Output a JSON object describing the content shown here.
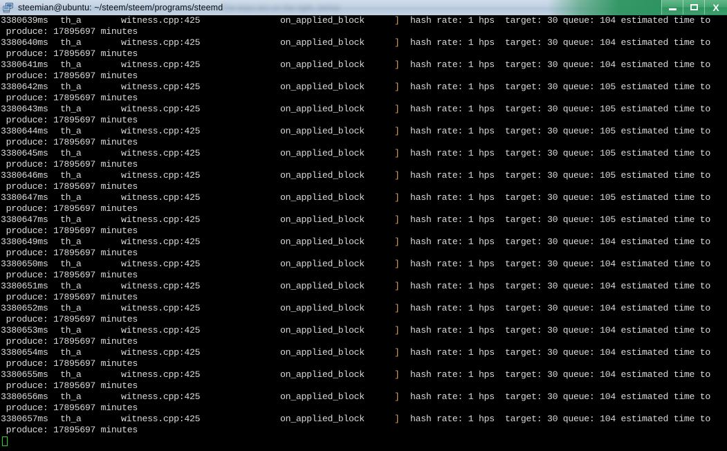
{
  "window": {
    "title": "steemian@ubuntu: ~/steem/steem/programs/steemd",
    "icon": "putty-computers-icon",
    "background_hint_text": "The  keys are on the right, below.",
    "colors": {
      "terminal_background": "#000000",
      "terminal_foreground": "#d6d6d6",
      "bracket_accent": "#c8a06a",
      "cursor": "#22dd22",
      "titlebar_glass": "#cbdbee",
      "titlebar_green": "#248e5a"
    },
    "controls": {
      "minimize_label": "–",
      "maximize_label": "□",
      "close_label": "X"
    }
  },
  "terminal": {
    "log_lines": [
      {
        "timestamp": "3380639ms",
        "thread": "th_a",
        "source": "witness.cpp:425",
        "function": "on_applied_block",
        "bracket": "]",
        "message": "hash rate: 1 hps  target: 30 queue: 104 estimated time to",
        "continuation": " produce: 17895697 minutes"
      },
      {
        "timestamp": "3380640ms",
        "thread": "th_a",
        "source": "witness.cpp:425",
        "function": "on_applied_block",
        "bracket": "]",
        "message": "hash rate: 1 hps  target: 30 queue: 104 estimated time to",
        "continuation": " produce: 17895697 minutes"
      },
      {
        "timestamp": "3380641ms",
        "thread": "th_a",
        "source": "witness.cpp:425",
        "function": "on_applied_block",
        "bracket": "]",
        "message": "hash rate: 1 hps  target: 30 queue: 104 estimated time to",
        "continuation": " produce: 17895697 minutes"
      },
      {
        "timestamp": "3380642ms",
        "thread": "th_a",
        "source": "witness.cpp:425",
        "function": "on_applied_block",
        "bracket": "]",
        "message": "hash rate: 1 hps  target: 30 queue: 105 estimated time to",
        "continuation": " produce: 17895697 minutes"
      },
      {
        "timestamp": "3380643ms",
        "thread": "th_a",
        "source": "witness.cpp:425",
        "function": "on_applied_block",
        "bracket": "]",
        "message": "hash rate: 1 hps  target: 30 queue: 105 estimated time to",
        "continuation": " produce: 17895697 minutes"
      },
      {
        "timestamp": "3380644ms",
        "thread": "th_a",
        "source": "witness.cpp:425",
        "function": "on_applied_block",
        "bracket": "]",
        "message": "hash rate: 1 hps  target: 30 queue: 105 estimated time to",
        "continuation": " produce: 17895697 minutes"
      },
      {
        "timestamp": "3380645ms",
        "thread": "th_a",
        "source": "witness.cpp:425",
        "function": "on_applied_block",
        "bracket": "]",
        "message": "hash rate: 1 hps  target: 30 queue: 105 estimated time to",
        "continuation": " produce: 17895697 minutes"
      },
      {
        "timestamp": "3380646ms",
        "thread": "th_a",
        "source": "witness.cpp:425",
        "function": "on_applied_block",
        "bracket": "]",
        "message": "hash rate: 1 hps  target: 30 queue: 105 estimated time to",
        "continuation": " produce: 17895697 minutes"
      },
      {
        "timestamp": "3380647ms",
        "thread": "th_a",
        "source": "witness.cpp:425",
        "function": "on_applied_block",
        "bracket": "]",
        "message": "hash rate: 1 hps  target: 30 queue: 105 estimated time to",
        "continuation": " produce: 17895697 minutes"
      },
      {
        "timestamp": "3380647ms",
        "thread": "th_a",
        "source": "witness.cpp:425",
        "function": "on_applied_block",
        "bracket": "]",
        "message": "hash rate: 1 hps  target: 30 queue: 105 estimated time to",
        "continuation": " produce: 17895697 minutes"
      },
      {
        "timestamp": "3380649ms",
        "thread": "th_a",
        "source": "witness.cpp:425",
        "function": "on_applied_block",
        "bracket": "]",
        "message": "hash rate: 1 hps  target: 30 queue: 104 estimated time to",
        "continuation": " produce: 17895697 minutes"
      },
      {
        "timestamp": "3380650ms",
        "thread": "th_a",
        "source": "witness.cpp:425",
        "function": "on_applied_block",
        "bracket": "]",
        "message": "hash rate: 1 hps  target: 30 queue: 104 estimated time to",
        "continuation": " produce: 17895697 minutes"
      },
      {
        "timestamp": "3380651ms",
        "thread": "th_a",
        "source": "witness.cpp:425",
        "function": "on_applied_block",
        "bracket": "]",
        "message": "hash rate: 1 hps  target: 30 queue: 104 estimated time to",
        "continuation": " produce: 17895697 minutes"
      },
      {
        "timestamp": "3380652ms",
        "thread": "th_a",
        "source": "witness.cpp:425",
        "function": "on_applied_block",
        "bracket": "]",
        "message": "hash rate: 1 hps  target: 30 queue: 104 estimated time to",
        "continuation": " produce: 17895697 minutes"
      },
      {
        "timestamp": "3380653ms",
        "thread": "th_a",
        "source": "witness.cpp:425",
        "function": "on_applied_block",
        "bracket": "]",
        "message": "hash rate: 1 hps  target: 30 queue: 104 estimated time to",
        "continuation": " produce: 17895697 minutes"
      },
      {
        "timestamp": "3380654ms",
        "thread": "th_a",
        "source": "witness.cpp:425",
        "function": "on_applied_block",
        "bracket": "]",
        "message": "hash rate: 1 hps  target: 30 queue: 104 estimated time to",
        "continuation": " produce: 17895697 minutes"
      },
      {
        "timestamp": "3380655ms",
        "thread": "th_a",
        "source": "witness.cpp:425",
        "function": "on_applied_block",
        "bracket": "]",
        "message": "hash rate: 1 hps  target: 30 queue: 104 estimated time to",
        "continuation": " produce: 17895697 minutes"
      },
      {
        "timestamp": "3380656ms",
        "thread": "th_a",
        "source": "witness.cpp:425",
        "function": "on_applied_block",
        "bracket": "]",
        "message": "hash rate: 1 hps  target: 30 queue: 104 estimated time to",
        "continuation": " produce: 17895697 minutes"
      },
      {
        "timestamp": "3380657ms",
        "thread": "th_a",
        "source": "witness.cpp:425",
        "function": "on_applied_block",
        "bracket": "]",
        "message": "hash rate: 1 hps  target: 30 queue: 104 estimated time to",
        "continuation": " produce: 17895697 minutes"
      }
    ],
    "cursor_visible": true
  }
}
